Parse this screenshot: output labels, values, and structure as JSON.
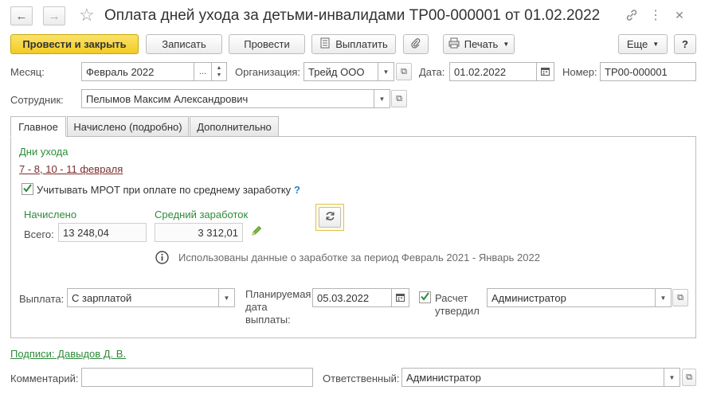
{
  "window": {
    "title": "Оплата дней ухода за детьми-инвалидами ТР00-000001 от 01.02.2022"
  },
  "toolbar": {
    "post_and_close": "Провести и закрыть",
    "save": "Записать",
    "post": "Провести",
    "pay": "Выплатить",
    "print": "Печать",
    "more": "Еще",
    "help": "?"
  },
  "header": {
    "month_label": "Месяц:",
    "month_value": "Февраль 2022",
    "month_dots": "...",
    "org_label": "Организация:",
    "org_value": "Трейд ООО",
    "date_label": "Дата:",
    "date_value": "01.02.2022",
    "number_label": "Номер:",
    "number_value": "ТР00-000001",
    "employee_label": "Сотрудник:",
    "employee_value": "Пелымов Максим Александрович"
  },
  "tabs": [
    {
      "label": "Главное",
      "active": true
    },
    {
      "label": "Начислено (подробно)",
      "active": false
    },
    {
      "label": "Дополнительно",
      "active": false
    }
  ],
  "main": {
    "care_days_title": "Дни ухода",
    "care_days_link": "7 - 8, 10 - 11 февраля",
    "mrot_label": "Учитывать МРОТ при оплате по среднему заработку",
    "mrot_checked": true,
    "mrot_help": "?",
    "accrued_title": "Начислено",
    "total_label": "Всего:",
    "total_value": "13 248,04",
    "avg_title": "Средний заработок",
    "avg_value": "3 312,01",
    "info_text": "Использованы данные о заработке за период Февраль 2021 - Январь 2022",
    "payment_label": "Выплата:",
    "payment_value": "С зарплатой",
    "planned_date_label_1": "Планируемая",
    "planned_date_label_2": "дата",
    "planned_date_label_3": "выплаты:",
    "planned_date_value": "05.03.2022",
    "calc_approved_label_1": "Расчет",
    "calc_approved_label_2": "утвердил",
    "calc_approved_checked": true,
    "approver_value": "Администратор"
  },
  "footer": {
    "signatures_link": "Подписи: Давыдов Д. В.",
    "comment_label": "Комментарий:",
    "comment_value": "",
    "responsible_label": "Ответственный:",
    "responsible_value": "Администратор"
  },
  "colors": {
    "accent_yellow": "#f5d12e",
    "green_text": "#2e8b3a",
    "link_red": "#7a2d2d"
  }
}
